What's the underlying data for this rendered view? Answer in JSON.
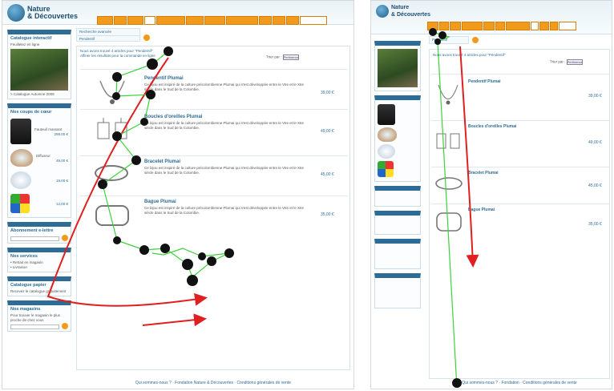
{
  "brand": {
    "name_line1": "Nature",
    "name_line2": "& Découvertes",
    "tagline": "nature · découvertes"
  },
  "colors": {
    "accent": "#f19a1b",
    "blue": "#2c6c96",
    "path_red": "#e02020",
    "gaze_green": "#3cd23c",
    "fixation": "#111111"
  },
  "left": {
    "search_title": "Recherche avancée",
    "search_value": "Pendentif",
    "results_info": "Nous avons trouvé 4 articles pour \"Pendentif\"",
    "results_sub": "Affiner les résultats pour la commande en ligne",
    "sort_label": "Trier par :",
    "sort_value": "Pertinence",
    "rows": [
      {
        "title": "Pendentif Plumai",
        "desc": "Ce bijou est inspiré de la culture précolombienne Plumai qui s'est développée entre le VIIe et le XIIe siècle dans le Sud de la Colombie.",
        "price": "39,00 €"
      },
      {
        "title": "Boucles d'oreilles Plumai",
        "desc": "Ce bijou est inspiré de la culture précolombienne Plumai qui s'est développée entre le VIIe et le XIIe siècle dans le Sud de la Colombie.",
        "price": "49,00 €"
      },
      {
        "title": "Bracelet Plumai",
        "desc": "Ce bijou est inspiré de la culture précolombienne Plumai qui s'est développée entre le VIIe et le XIIe siècle dans le Sud de la Colombie.",
        "price": "45,00 €"
      },
      {
        "title": "Bague Plumai",
        "desc": "Ce bijou est inspiré de la culture précolombienne Plumai qui s'est développée entre le VIIe et le XIIe siècle dans le Sud de la Colombie.",
        "price": "35,00 €"
      }
    ],
    "sidebar": {
      "catalogue_title": "Catalogue interactif",
      "catalogue_caption": "Feuilletez en ligne",
      "catalogue_link": "> Catalogue Automne 2009",
      "coups_title": "Nos coups de cœur",
      "coups_items": [
        {
          "label": "Fauteuil massant",
          "price": "299,00 €"
        },
        {
          "label": "Diffuseur",
          "price": "49,00 €"
        },
        {
          "label": "",
          "price": "19,00 €"
        },
        {
          "label": "",
          "price": "12,00 €"
        }
      ],
      "abonnement_title": "Abonnement e-lettre",
      "abonnement_btn": "OK",
      "services_title": "Nos services",
      "services_items": [
        "• Retrait en magasin",
        "• Livraison"
      ],
      "catalogue_papier_title": "Catalogue papier",
      "catalogue_papier_text": "Recevez le catalogue gratuitement",
      "magasins_title": "Nos magasins",
      "magasins_text": "Pour trouver le magasin le plus proche de chez vous"
    },
    "footer": "Qui sommes-nous ? · Fondation Nature & Découvertes · Conditions générales de vente"
  },
  "right": {
    "search_value": "Pendentif",
    "results_info": "Nous avons trouvé 4 articles pour \"Pendentif\"",
    "sort_label": "Trier par :",
    "sort_value": "Pertinence",
    "rows": [
      {
        "title": "Pendentif Plumai",
        "price": "39,00 €"
      },
      {
        "title": "Boucles d'oreilles Plumai",
        "price": "49,00 €"
      },
      {
        "title": "Bracelet Plumai",
        "price": "45,00 €"
      },
      {
        "title": "Bague Plumai",
        "price": "35,00 €"
      }
    ],
    "footer": "Qui sommes-nous ? · Fondation · Conditions générales de vente"
  }
}
